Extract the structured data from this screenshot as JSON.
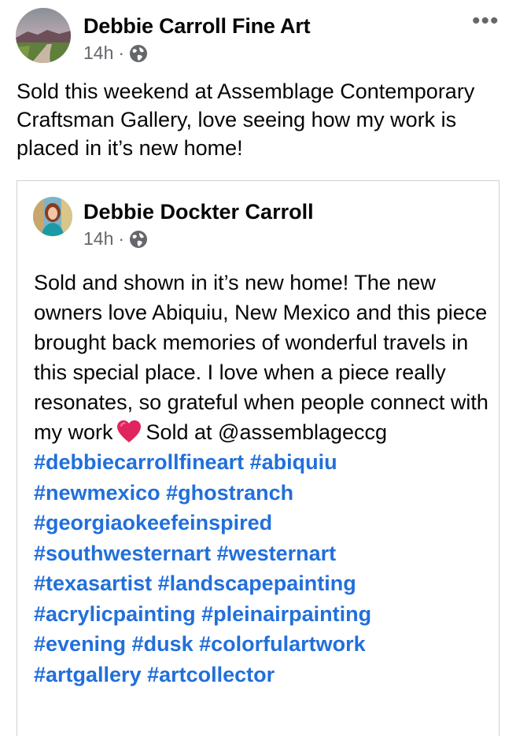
{
  "post": {
    "author": "Debbie Carroll Fine Art",
    "time": "14h",
    "separator": "·",
    "audience_icon": "globe-icon",
    "more_icon": "more-options-icon",
    "more_label": "•••",
    "text": "Sold this weekend at Assemblage Contemporary Craftsman Gallery, love seeing how my work is placed in it’s new home!"
  },
  "shared_post": {
    "author": "Debbie Dockter Carroll",
    "time": "14h",
    "separator": "·",
    "audience_icon": "globe-icon",
    "text_before_emoji": "Sold and shown in it’s new home! The new owners love Abiquiu, New Mexico and this piece brought back memories of wonderful travels in this special place. I love when a piece really resonates, so grateful when people connect with my work",
    "emoji_icon": "red-heart-icon",
    "text_after_emoji": "Sold at @assemblageccg",
    "hashtags": [
      "#debbiecarrollfineart",
      "#abiquiu",
      "#newmexico",
      "#ghostranch",
      "#georgiaokeefeinspired",
      "#southwesternart",
      "#westernart",
      "#texasartist",
      "#landscapepainting",
      "#acrylicpainting",
      "#pleinairpainting",
      "#evening",
      "#dusk",
      "#colorfulartwork",
      "#artgallery",
      "#artcollector"
    ]
  },
  "colors": {
    "link": "#216fdb",
    "meta": "#65676b",
    "text": "#050505",
    "border": "#ced0d4",
    "heart": "#e0245e"
  }
}
